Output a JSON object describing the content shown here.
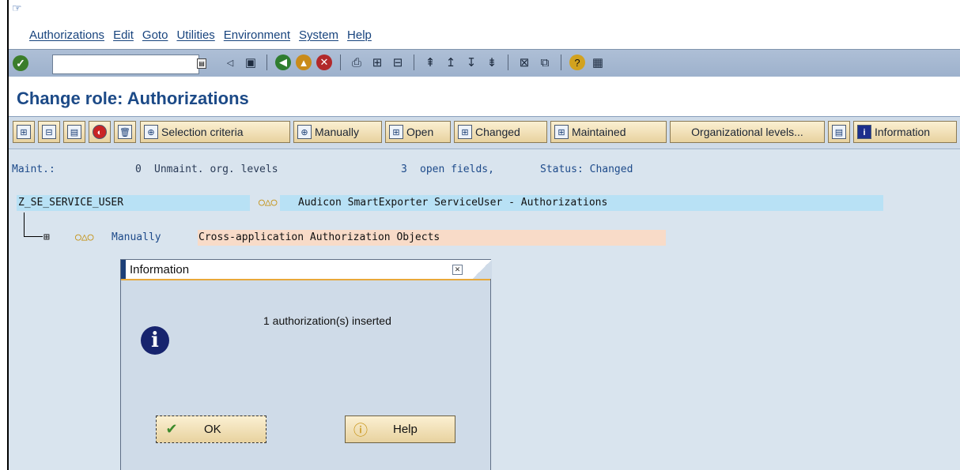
{
  "menu": [
    "Authorizations",
    "Edit",
    "Goto",
    "Utilities",
    "Environment",
    "System",
    "Help"
  ],
  "toolbar": {
    "command_value": "",
    "icons": [
      "enter-icon",
      "save-icon",
      "back-icon",
      "exit-icon",
      "cancel-icon",
      "print-icon",
      "find-icon",
      "find-next-icon",
      "first-page-icon",
      "previous-page-icon",
      "next-page-icon",
      "last-page-icon",
      "create-session-icon",
      "shortcut-icon",
      "help-icon",
      "layout-icon"
    ]
  },
  "title": "Change role: Authorizations",
  "app_toolbar": {
    "selection_criteria": "Selection criteria",
    "manually": "Manually",
    "open": "Open",
    "changed": "Changed",
    "maintained": "Maintained",
    "org_levels": "Organizational levels...",
    "information": "Information"
  },
  "status_line": {
    "label": "Maint.:",
    "count": "0",
    "unmaint": "Unmaint. org. levels",
    "open_count": "3",
    "open_fields": "open fields,",
    "status": "Status: Changed"
  },
  "tree": {
    "role": "Z_SE_SERVICE_USER",
    "role_desc": "Audicon SmartExporter ServiceUser - Authorizations",
    "node_type": "Manually",
    "node_desc": "Cross-application Authorization Objects"
  },
  "dialog": {
    "title": "Information",
    "message": "1 authorization(s) inserted",
    "ok": "OK",
    "help": "Help"
  },
  "colors": {
    "toolbar": "#9db1cc",
    "background": "#d9e4ee",
    "title": "#1c4a87",
    "role_bar": "#b8e1f5",
    "node_bar": "#f8dbc8",
    "dialog_accent": "#e8a83a"
  }
}
